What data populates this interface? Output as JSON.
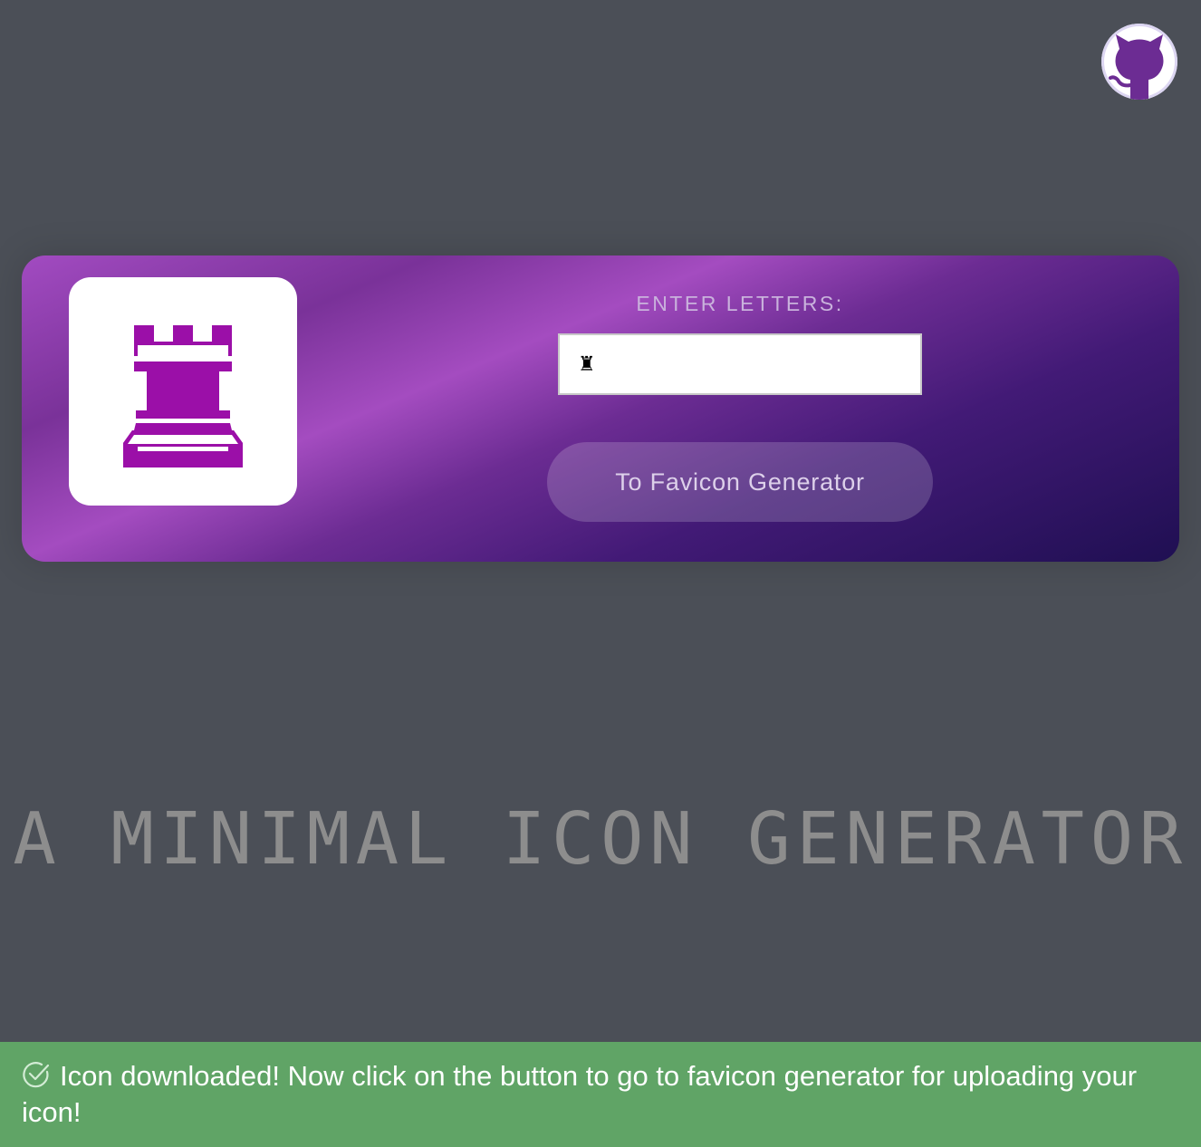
{
  "header": {
    "github_icon": "github-octocat-icon"
  },
  "generator": {
    "preview_icon": "chess-rook-icon",
    "icon_color": "#9b0fa8",
    "label": "ENTER LETTERS:",
    "input_value": "♜",
    "button_label": "To Favicon Generator"
  },
  "tagline": "A MINIMAL ICON GENERATOR",
  "toast": {
    "icon": "check-circle-icon",
    "message": "Icon downloaded! Now click on the button to go to favicon generator for uploading your icon!"
  },
  "colors": {
    "background": "#4b4f57",
    "toast": "#60a466",
    "gradient_light": "#a44cc0",
    "gradient_dark": "#1f0f52"
  }
}
